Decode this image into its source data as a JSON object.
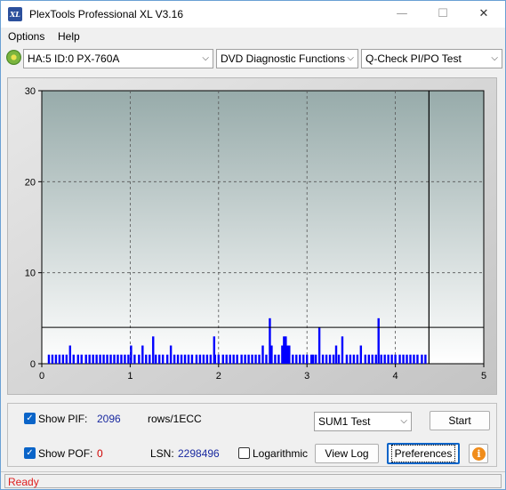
{
  "window": {
    "title": "PlexTools Professional XL V3.16",
    "app_icon_text": "XL",
    "min_glyph": "—",
    "max_glyph": "☐",
    "close_glyph": "✕"
  },
  "menu": {
    "options": "Options",
    "help": "Help"
  },
  "toolbar": {
    "drive": "HA:5 ID:0  PX-760A",
    "function": "DVD Diagnostic Functions",
    "test": "Q-Check PI/PO Test",
    "arrow": "⌵"
  },
  "chart_data": {
    "type": "bar",
    "x_range": [
      0,
      5
    ],
    "y_range": [
      0,
      30
    ],
    "x_ticks": [
      "0",
      "1",
      "2",
      "3",
      "4",
      "5"
    ],
    "y_ticks": [
      "0",
      "10",
      "20",
      "30"
    ],
    "threshold_line": 4,
    "end_marker_x": 4.38,
    "grid": true,
    "series_color": "#0000ff",
    "x": [
      0.08,
      0.12,
      0.16,
      0.2,
      0.24,
      0.28,
      0.32,
      0.36,
      0.41,
      0.45,
      0.5,
      0.54,
      0.58,
      0.62,
      0.66,
      0.7,
      0.74,
      0.78,
      0.82,
      0.86,
      0.9,
      0.94,
      0.98,
      1.01,
      1.05,
      1.1,
      1.14,
      1.18,
      1.22,
      1.26,
      1.29,
      1.33,
      1.37,
      1.42,
      1.46,
      1.5,
      1.54,
      1.58,
      1.62,
      1.66,
      1.7,
      1.75,
      1.79,
      1.83,
      1.87,
      1.91,
      1.95,
      1.96,
      2.0,
      2.05,
      2.09,
      2.13,
      2.17,
      2.21,
      2.26,
      2.3,
      2.34,
      2.38,
      2.42,
      2.46,
      2.5,
      2.54,
      2.58,
      2.6,
      2.64,
      2.68,
      2.72,
      2.74,
      2.76,
      2.78,
      2.8,
      2.84,
      2.88,
      2.92,
      2.96,
      3.0,
      3.05,
      3.07,
      3.1,
      3.14,
      3.18,
      3.22,
      3.26,
      3.3,
      3.33,
      3.36,
      3.4,
      3.45,
      3.49,
      3.53,
      3.57,
      3.61,
      3.66,
      3.7,
      3.74,
      3.78,
      3.81,
      3.84,
      3.88,
      3.92,
      3.96,
      4.0,
      4.05,
      4.09,
      4.13,
      4.17,
      4.21,
      4.25,
      4.3,
      4.34
    ],
    "values": [
      1,
      1,
      1,
      1,
      1,
      1,
      2,
      1,
      1,
      1,
      1,
      1,
      1,
      1,
      1,
      1,
      1,
      1,
      1,
      1,
      1,
      1,
      1,
      2,
      1,
      1,
      2,
      1,
      1,
      3,
      1,
      1,
      1,
      1,
      2,
      1,
      1,
      1,
      1,
      1,
      1,
      1,
      1,
      1,
      1,
      1,
      3,
      1,
      1,
      1,
      1,
      1,
      1,
      1,
      1,
      1,
      1,
      1,
      1,
      1,
      2,
      1,
      5,
      2,
      1,
      1,
      2,
      3,
      3,
      2,
      2,
      1,
      1,
      1,
      1,
      1,
      1,
      1,
      1,
      4,
      1,
      1,
      1,
      1,
      2,
      1,
      3,
      1,
      1,
      1,
      1,
      2,
      1,
      1,
      1,
      1,
      5,
      1,
      1,
      1,
      1,
      1,
      1,
      1,
      1,
      1,
      1,
      1,
      1,
      1
    ]
  },
  "controls": {
    "show_pif_label": "Show PIF:",
    "pif_value": "2096",
    "pif_unit": "rows/1ECC",
    "show_pof_label": "Show POF:",
    "pof_value": "0",
    "lsn_label": "LSN:",
    "lsn_value": "2298496",
    "logarithmic_label": "Logarithmic",
    "sum_select": "SUM1 Test",
    "start_button": "Start",
    "view_log_button": "View Log",
    "preferences_button": "Preferences",
    "check_glyph": "✓",
    "info_glyph": "i"
  },
  "status": {
    "text": "Ready"
  }
}
